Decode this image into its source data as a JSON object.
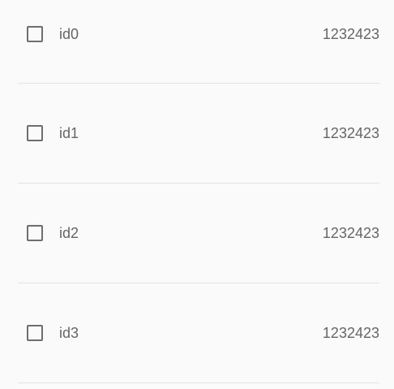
{
  "list": {
    "items": [
      {
        "label": "id0",
        "value": "1232423",
        "checked": false
      },
      {
        "label": "id1",
        "value": "1232423",
        "checked": false
      },
      {
        "label": "id2",
        "value": "1232423",
        "checked": false
      },
      {
        "label": "id3",
        "value": "1232423",
        "checked": false
      }
    ]
  },
  "colors": {
    "background": "#fafafa",
    "text": "#666666",
    "checkbox_border": "#6e6e6e",
    "divider": "#e3e3e3"
  }
}
